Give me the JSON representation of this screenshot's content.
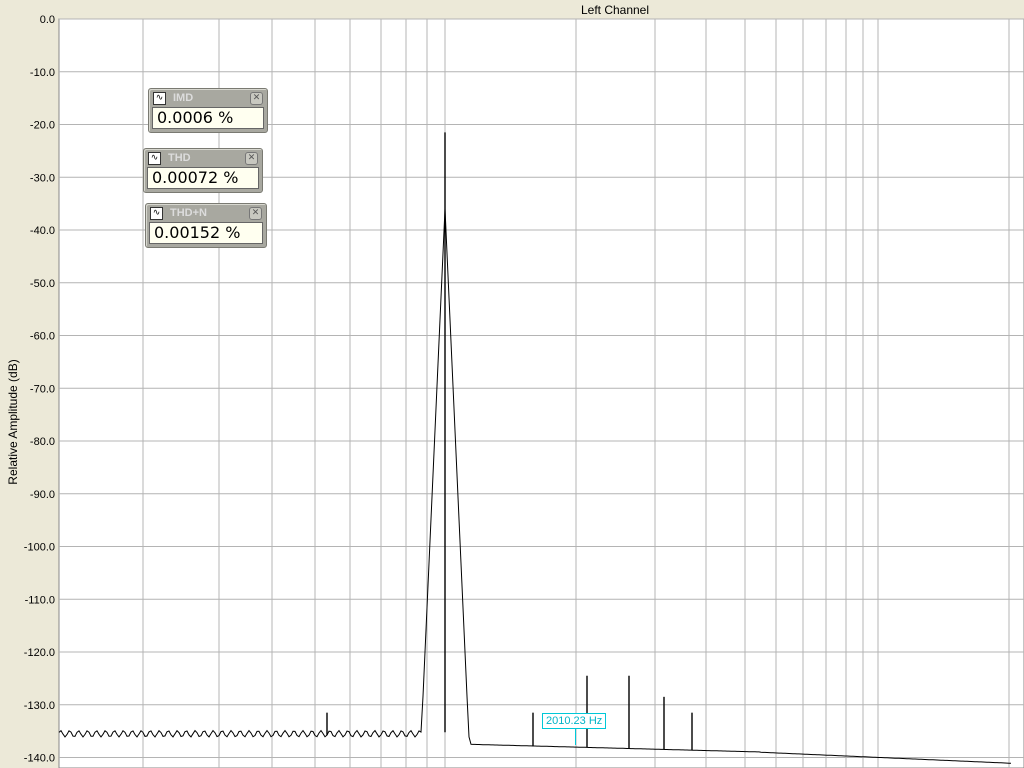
{
  "chart_data": {
    "type": "line",
    "title": "Left Channel",
    "ylabel": "Relative Amplitude (dB)",
    "xlabel": "",
    "ylim": [
      -140,
      0
    ],
    "yticks": [
      "0.0",
      "-10.0",
      "-20.0",
      "-30.0",
      "-40.0",
      "-50.0",
      "-60.0",
      "-70.0",
      "-80.0",
      "-90.0",
      "-100.0",
      "-110.0",
      "-120.0",
      "-130.0",
      "-140.0"
    ],
    "grid": true,
    "x_scale": "log",
    "series": [
      {
        "peaks_db": [
          -21.5,
          -131.5,
          -124.5,
          -124.5,
          -128.5,
          -131.5,
          -131.5
        ]
      }
    ]
  },
  "meters": [
    {
      "label": "IMD",
      "value": "0.0006 %"
    },
    {
      "label": "THD",
      "value": "0.00072 %"
    },
    {
      "label": "THD+N",
      "value": "0.00152 %"
    }
  ],
  "marker": {
    "text": "2010.23 Hz"
  },
  "colors": {
    "background": "#ece9d8",
    "grid": "#b4b4b4",
    "trace": "#000000",
    "marker": "#00c8d8",
    "meter": "#a8a8a0"
  },
  "icons": {
    "meter_icon": "waveform-icon",
    "close_icon": "close-icon"
  }
}
